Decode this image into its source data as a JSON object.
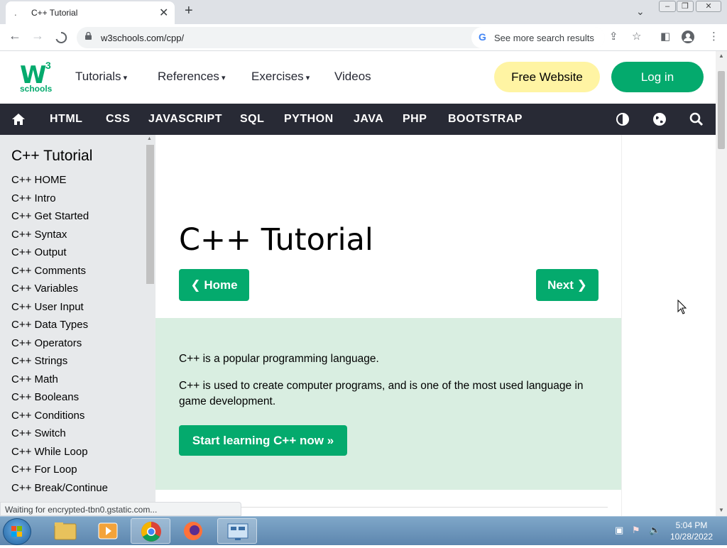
{
  "browser": {
    "tab_title": "C++ Tutorial",
    "tab_favicon": ".",
    "url": "w3schools.com/cpp/",
    "search_suggestion": "See more search results",
    "status_text": "Waiting for encrypted-tbn0.gstatic.com..."
  },
  "site": {
    "logo_mark": "W",
    "logo_superscript": "3",
    "logo_text": "schools",
    "menu": [
      {
        "label": "Tutorials",
        "caret": "▾"
      },
      {
        "label": "References",
        "caret": "▾"
      },
      {
        "label": "Exercises",
        "caret": "▾"
      },
      {
        "label": "Videos"
      }
    ],
    "free_website_label": "Free Website",
    "login_label": "Log in",
    "subnav": [
      "HTML",
      "CSS",
      "JAVASCRIPT",
      "SQL",
      "PYTHON",
      "JAVA",
      "PHP",
      "BOOTSTRAP"
    ]
  },
  "sidebar": {
    "title": "C++ Tutorial",
    "items": [
      "C++ HOME",
      "C++ Intro",
      "C++ Get Started",
      "C++ Syntax",
      "C++ Output",
      "C++ Comments",
      "C++ Variables",
      "C++ User Input",
      "C++ Data Types",
      "C++ Operators",
      "C++ Strings",
      "C++ Math",
      "C++ Booleans",
      "C++ Conditions",
      "C++ Switch",
      "C++ While Loop",
      "C++ For Loop",
      "C++ Break/Continue"
    ]
  },
  "main": {
    "heading": "C++ Tutorial",
    "home_button": "❮ Home",
    "next_button": "Next ❯",
    "intro_p1": "C++ is a popular programming language.",
    "intro_p2": "C++ is used to create computer programs, and is one of the most used language in game development.",
    "cta_button": "Start learning C++ now »"
  },
  "taskbar": {
    "time": "5:04 PM",
    "date": "10/28/2022"
  },
  "colors": {
    "brand_green": "#04aa6d",
    "dark_nav": "#282a35",
    "free_btn": "#fff4a3",
    "sidebar_bg": "#e7e9eb",
    "intro_bg": "#d9eee1"
  }
}
